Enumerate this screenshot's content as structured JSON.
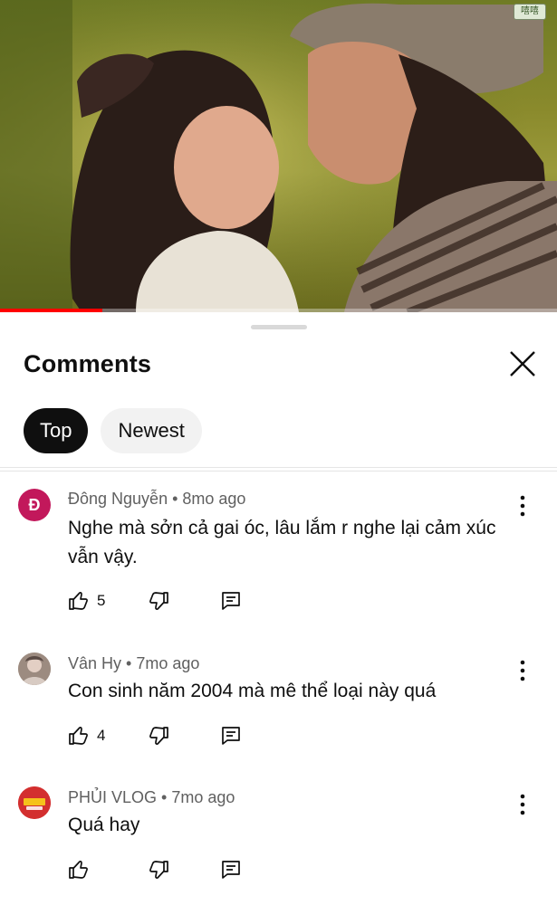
{
  "video": {
    "watermark": "嘻嘻",
    "progress": 0.184
  },
  "sheet": {
    "title": "Comments",
    "chips": [
      "Top",
      "Newest"
    ]
  },
  "comments": [
    {
      "avatar_letter": "Đ",
      "avatar_color": "#c2185b",
      "meta": "Đông Nguyễn • 8mo ago",
      "text": "Nghe mà sởn cả gai óc, lâu lắm r nghe lại cảm xúc vẫn vậy.",
      "likes": "5"
    },
    {
      "avatar_letter": "",
      "avatar_color": "#b9a89a",
      "meta": "Vân Hy • 7mo ago",
      "text": "Con sinh năm 2004 mà mê thể loại này quá",
      "likes": "4"
    },
    {
      "avatar_letter": "PHỦI VLOG",
      "avatar_color": "#d32f2f",
      "meta": "PHỦI VLOG • 7mo ago",
      "text": "Quá hay",
      "likes": ""
    }
  ],
  "icons": {
    "like": "thumb-up-icon",
    "dislike": "thumb-down-icon",
    "reply": "reply-comment-icon",
    "more": "more-vert-icon",
    "close": "close-icon"
  },
  "colors": {
    "progress": "#ff0000",
    "chip_active_bg": "#0f0f0f",
    "chip_inactive_bg": "#f2f2f2"
  }
}
